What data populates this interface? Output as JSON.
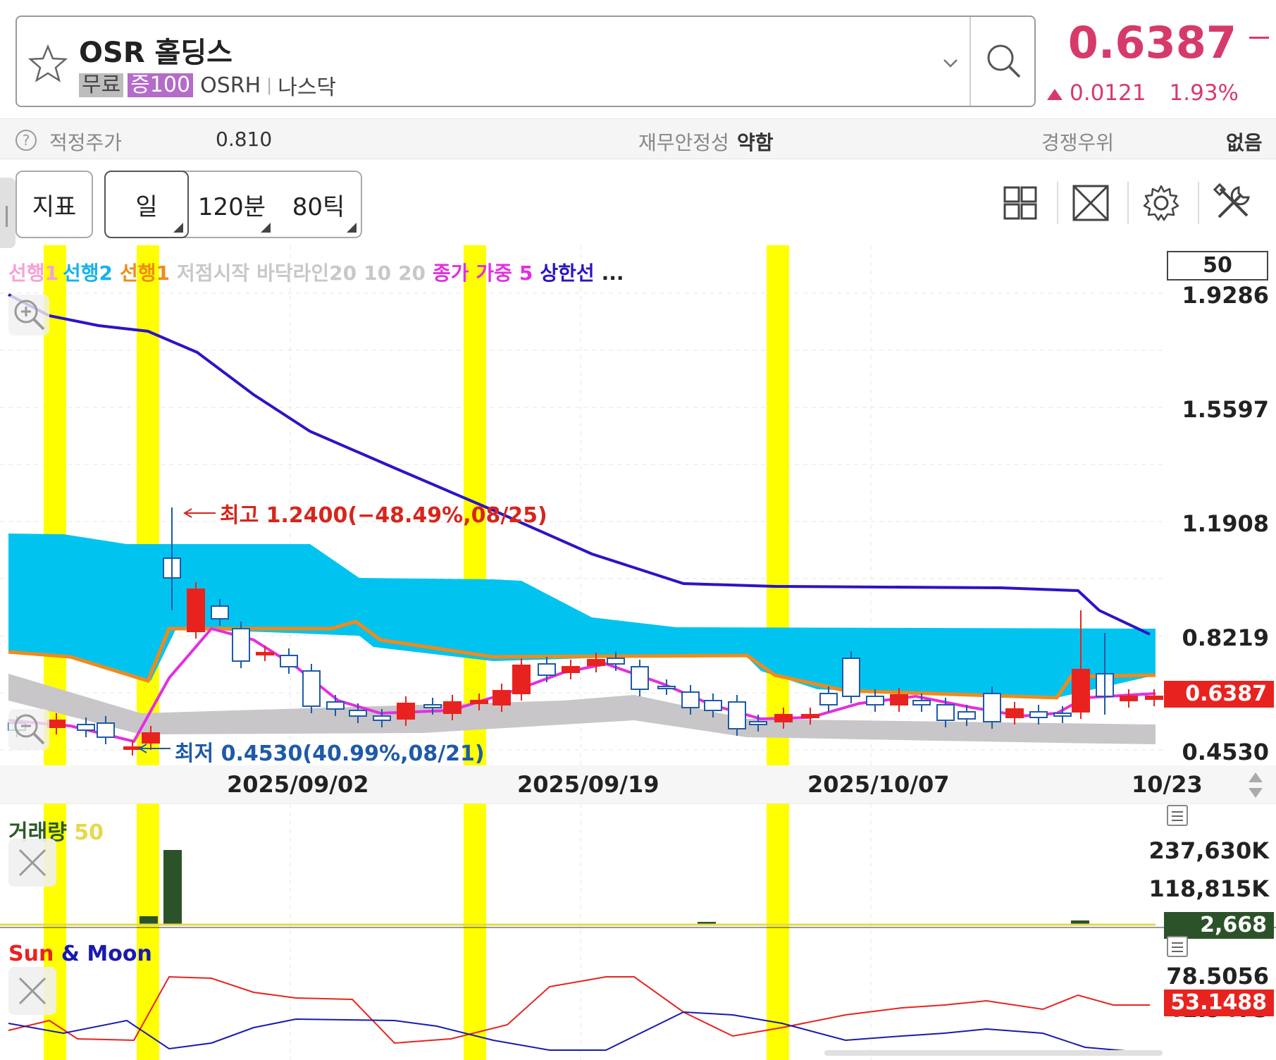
{
  "header": {
    "stock_name": "OSR 홀딩스",
    "tag_free": "무료",
    "tag_margin": "증100",
    "ticker": "OSRH",
    "market": "나스닥",
    "price": "0.6387",
    "change": "0.0121",
    "change_pct": "1.93%",
    "accent_color": "#d63a6b"
  },
  "info_bar": {
    "fair_price_label": "적정주가",
    "fair_price_value": "0.810",
    "stability_label": "재무안정성",
    "stability_value": "약함",
    "competitive_label": "경쟁우위",
    "competitive_value": "없음",
    "help_icon": "?"
  },
  "toolbar": {
    "indicator_label": "지표",
    "period_day": "일",
    "period_minutes": "120분",
    "period_ticks": "80틱",
    "icons": [
      "grid-layout-icon",
      "expand-icon",
      "gear-icon",
      "tools-icon"
    ]
  },
  "legend": {
    "lead1": "선행1",
    "lead2": "선행2",
    "lead1b": "선행1",
    "low_start": "저점시작",
    "floor_line": "바닥라인20",
    "params": "10",
    "params2": "20",
    "close_weighted": "종가 가중",
    "ma5": "5",
    "upper_line": "상한선",
    "more": "..."
  },
  "chart": {
    "period_count": "50",
    "y_labels": [
      "1.9286",
      "1.5597",
      "1.1908",
      "0.8219",
      "0.4530"
    ],
    "current_tag": "0.6387",
    "date_labels": [
      "2025/09/02",
      "2025/09/19",
      "2025/10/07",
      "10/23"
    ],
    "high_annotation": "최고 1.2400(−48.49%,08/25)",
    "low_annotation": "최저 0.4530(40.99%,08/21)"
  },
  "volume_panel": {
    "title": "거래량",
    "period": "50",
    "y_labels": [
      "237,630K",
      "118,815K"
    ],
    "current_tag": "2,668"
  },
  "sunmoon_panel": {
    "title_sun": "Sun",
    "title_amp": "&",
    "title_moon": "Moon",
    "y_top": "78.5056",
    "current_tag": "53.1488",
    "y_bottom_partial": "41.9473"
  },
  "chart_data": {
    "type": "candlestick",
    "series": [
      {
        "name": "candles",
        "points": [
          {
            "o": 0.52,
            "h": 0.53,
            "l": 0.5,
            "c": 0.52
          },
          {
            "o": 0.52,
            "h": 0.53,
            "l": 0.51,
            "c": 0.51
          },
          {
            "o": 0.5,
            "h": 0.51,
            "l": 0.49,
            "c": 0.5
          },
          {
            "o": 0.5,
            "h": 0.51,
            "l": 0.49,
            "c": 0.53
          },
          {
            "o": 0.48,
            "h": 0.48,
            "l": 0.48,
            "c": 0.48
          },
          {
            "o": 0.5,
            "h": 0.51,
            "l": 0.46,
            "c": 0.49
          },
          {
            "o": 0.99,
            "h": 1.24,
            "l": 0.9,
            "c": 1.08
          },
          {
            "o": 1.0,
            "h": 1.02,
            "l": 0.81,
            "c": 0.82
          },
          {
            "o": 0.9,
            "h": 0.95,
            "l": 0.88,
            "c": 0.94
          },
          {
            "o": 0.85,
            "h": 0.9,
            "l": 0.7,
            "c": 0.71
          },
          {
            "o": 0.76,
            "h": 0.84,
            "l": 0.73,
            "c": 0.76
          },
          {
            "o": 0.73,
            "h": 0.83,
            "l": 0.71,
            "c": 0.75
          }
        ]
      }
    ]
  }
}
